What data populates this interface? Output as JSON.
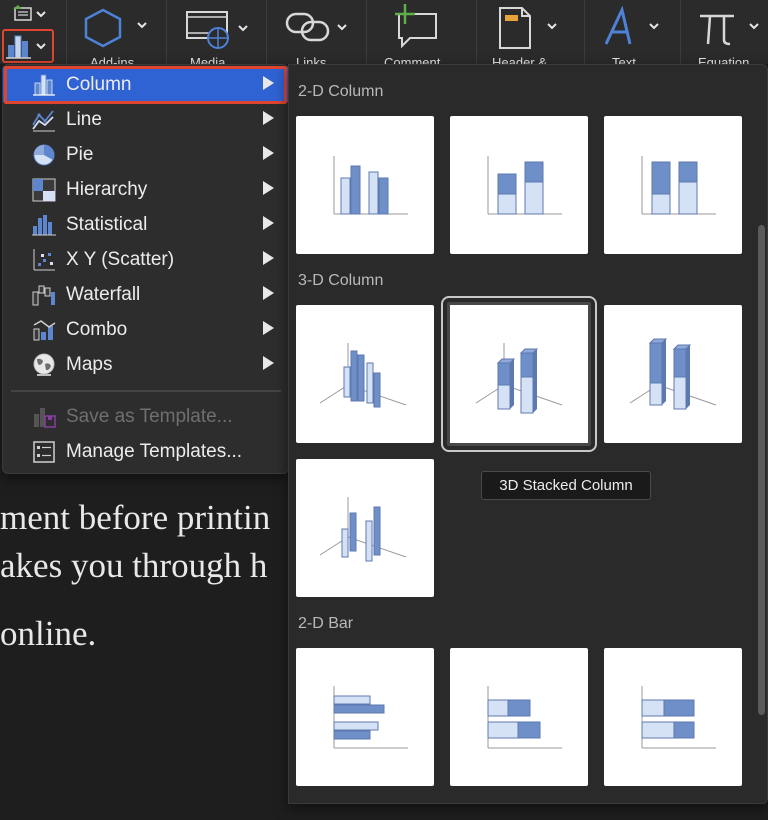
{
  "ribbon": {
    "tools": [
      {
        "name": "addins",
        "label": "Add-ins"
      },
      {
        "name": "media",
        "label": "Media"
      },
      {
        "name": "links",
        "label": "Links"
      },
      {
        "name": "comment",
        "label": "Comment"
      },
      {
        "name": "header",
        "label": "Header &"
      },
      {
        "name": "text",
        "label": "Text"
      },
      {
        "name": "equation",
        "label": "Equation"
      }
    ]
  },
  "menu": {
    "items": [
      {
        "label": "Column",
        "icon": "column-chart-icon",
        "submenu": true,
        "selected": true
      },
      {
        "label": "Line",
        "icon": "line-chart-icon",
        "submenu": true
      },
      {
        "label": "Pie",
        "icon": "pie-chart-icon",
        "submenu": true
      },
      {
        "label": "Hierarchy",
        "icon": "hierarchy-chart-icon",
        "submenu": true
      },
      {
        "label": "Statistical",
        "icon": "statistical-chart-icon",
        "submenu": true
      },
      {
        "label": "X Y (Scatter)",
        "icon": "scatter-chart-icon",
        "submenu": true
      },
      {
        "label": "Waterfall",
        "icon": "waterfall-chart-icon",
        "submenu": true
      },
      {
        "label": "Combo",
        "icon": "combo-chart-icon",
        "submenu": true
      },
      {
        "label": "Maps",
        "icon": "maps-chart-icon",
        "submenu": true
      }
    ],
    "templates": [
      {
        "label": "Save as Template...",
        "icon": "save-template-icon",
        "disabled": true
      },
      {
        "label": "Manage Templates...",
        "icon": "manage-templates-icon",
        "disabled": false
      }
    ]
  },
  "gallery": {
    "sections": [
      {
        "title": "2-D Column",
        "items": [
          "Clustered Column",
          "Stacked Column",
          "100% Stacked Column"
        ]
      },
      {
        "title": "3-D Column",
        "items": [
          "3D Clustered Column",
          "3D Stacked Column",
          "3D 100% Stacked Column",
          "3D Column"
        ]
      },
      {
        "title": "2-D Bar",
        "items": [
          "Clustered Bar",
          "Stacked Bar",
          "100% Stacked Bar"
        ]
      }
    ],
    "hovered": "3D Stacked Column",
    "tooltip": "3D Stacked Column"
  },
  "document": {
    "lines": [
      "ment before printin",
      "akes you through h",
      " online."
    ]
  },
  "colors": {
    "highlight_border": "#e0452f",
    "selected_bg": "#2f62d3",
    "bar_dark": "#6f8fc8",
    "bar_light": "#d5e2f5"
  }
}
